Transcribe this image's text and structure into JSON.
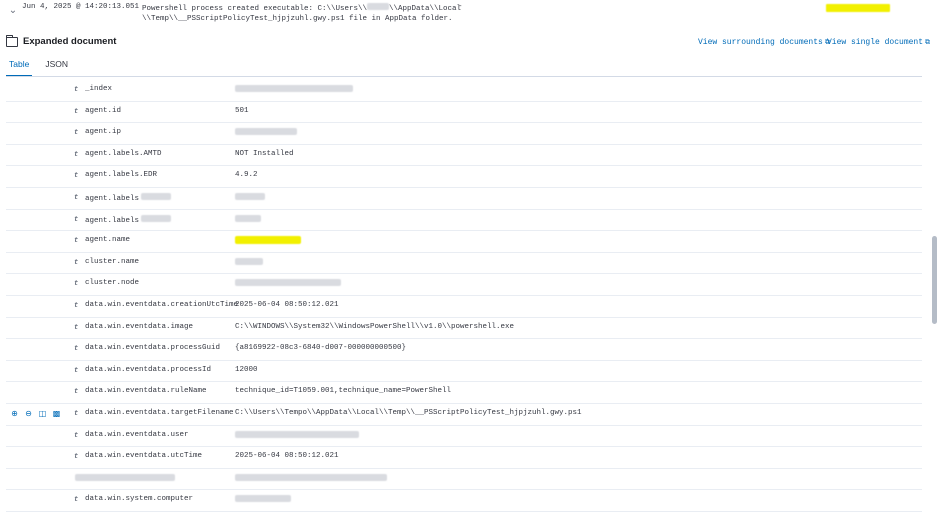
{
  "event": {
    "timestamp": "Jun 4, 2025 @ 14:20:13.051",
    "message_line1": "Powershell process created executable: C:\\\\Users\\\\",
    "message_line1b": "\\\\AppData\\\\Local",
    "message_line2": "\\\\Temp\\\\__PSScriptPolicyTest_hjpjzuhl.gwy.ps1 file in AppData folder.",
    "dash": "-"
  },
  "doc": {
    "title": "Expanded document",
    "link_surrounding": "View surrounding documents",
    "link_single": "View single document"
  },
  "tabs": [
    {
      "label": "Table",
      "active": true
    },
    {
      "label": "JSON",
      "active": false
    }
  ],
  "fields": [
    {
      "type": "t",
      "name": "_index",
      "value": ""
    },
    {
      "type": "t",
      "name": "agent.id",
      "value": "501"
    },
    {
      "type": "t",
      "name": "agent.ip",
      "value": ""
    },
    {
      "type": "t",
      "name": "agent.labels.AMTD",
      "value": "NOT Installed"
    },
    {
      "type": "t",
      "name": "agent.labels.EDR",
      "value": "4.9.2"
    },
    {
      "type": "t",
      "name": "agent.labels",
      "value": ""
    },
    {
      "type": "t",
      "name": "agent.labels",
      "value": ""
    },
    {
      "type": "t",
      "name": "agent.name",
      "value": ""
    },
    {
      "type": "t",
      "name": "cluster.name",
      "value": ""
    },
    {
      "type": "t",
      "name": "cluster.node",
      "value": ""
    },
    {
      "type": "t",
      "name": "data.win.eventdata.creationUtcTime",
      "value": "2025-06-04 08:50:12.021"
    },
    {
      "type": "t",
      "name": "data.win.eventdata.image",
      "value": "C:\\\\WINDOWS\\\\System32\\\\WindowsPowerShell\\\\v1.0\\\\powershell.exe"
    },
    {
      "type": "t",
      "name": "data.win.eventdata.processGuid",
      "value": "{a8169922-08c3-6840-d007-000000000500}"
    },
    {
      "type": "t",
      "name": "data.win.eventdata.processId",
      "value": "12000"
    },
    {
      "type": "t",
      "name": "data.win.eventdata.ruleName",
      "value": "technique_id=T1059.001,technique_name=PowerShell"
    },
    {
      "type": "t",
      "name": "data.win.eventdata.targetFilename",
      "value": "C:\\\\Users\\\\Tempo\\\\AppData\\\\Local\\\\Temp\\\\__PSScriptPolicyTest_hjpjzuhl.gwy.ps1"
    },
    {
      "type": "t",
      "name": "data.win.eventdata.user",
      "value": ""
    },
    {
      "type": "t",
      "name": "data.win.eventdata.utcTime",
      "value": "2025-06-04 08:50:12.021"
    },
    {
      "type": "",
      "name": "",
      "value": ""
    },
    {
      "type": "t",
      "name": "data.win.system.computer",
      "value": ""
    }
  ],
  "colors": {
    "accent": "#006bb8",
    "highlight": "#f2f000"
  }
}
